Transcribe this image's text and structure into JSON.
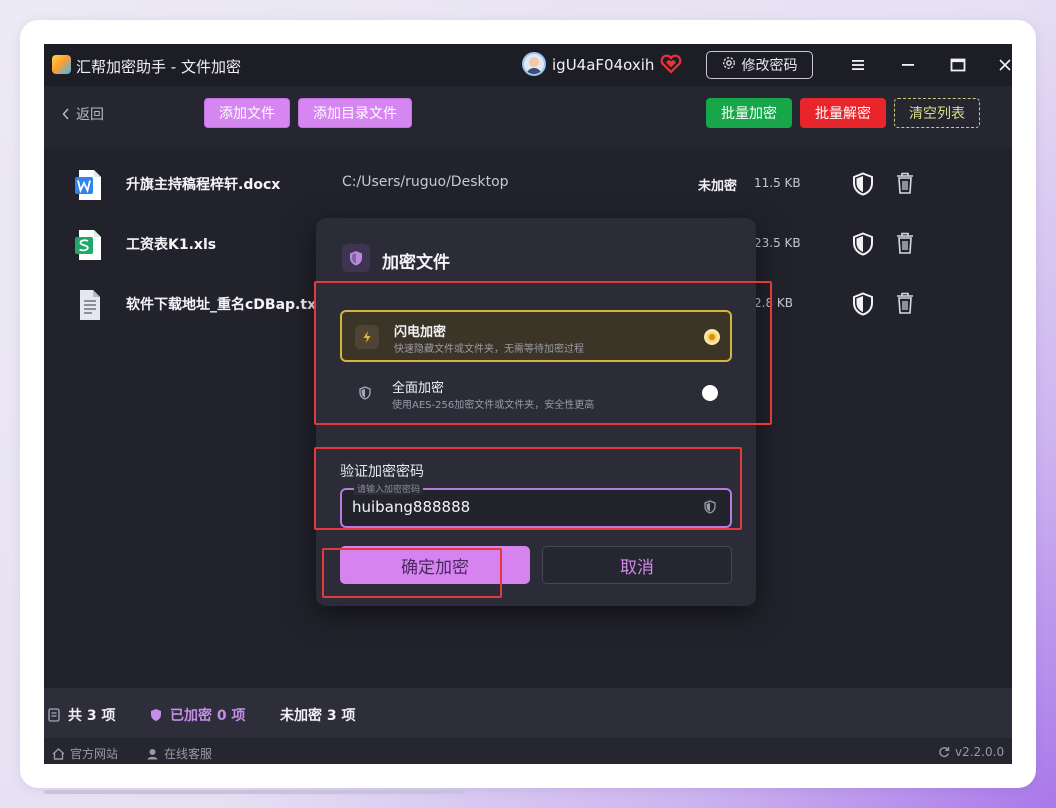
{
  "window": {
    "title": "汇帮加密助手 - 文件加密",
    "username": "igU4aF04oxih",
    "change_password_label": "修改密码",
    "buttons": {
      "menu": "≡",
      "minimize": "—",
      "maximize": "□",
      "close": "×"
    }
  },
  "toolbar": {
    "back_label": "返回",
    "add_file_label": "添加文件",
    "add_dir_label": "添加目录文件",
    "batch_encrypt_label": "批量加密",
    "batch_decrypt_label": "批量解密",
    "clear_list_label": "清空列表"
  },
  "files": [
    {
      "name": "升旗主持稿程梓轩.docx",
      "path": "C:/Users/ruguo/Desktop",
      "status": "未加密",
      "size": "11.5 KB",
      "icon": "word-doc-icon",
      "icon_color": "#2f86e8"
    },
    {
      "name": "工资表K1.xls",
      "path": "",
      "status": "",
      "size": "23.5 KB",
      "icon": "spreadsheet-icon",
      "icon_color": "#20a866"
    },
    {
      "name": "软件下载地址_重名cDBap.txt",
      "path": "",
      "status": "",
      "size": "2.8 KB",
      "icon": "text-file-icon",
      "icon_color": "#e6e6ee"
    }
  ],
  "dialog": {
    "title": "加密文件",
    "options": [
      {
        "title": "闪电加密",
        "desc": "快速隐藏文件或文件夹，无需等待加密过程",
        "selected": true,
        "icon": "lightning-icon"
      },
      {
        "title": "全面加密",
        "desc": "使用AES-256加密文件或文件夹，安全性更高",
        "selected": false,
        "icon": "shield-icon"
      }
    ],
    "password_label": "验证加密密码",
    "password_placeholder": "请输入加密密码",
    "password_value": "huibang888888",
    "confirm_label": "确定加密",
    "cancel_label": "取消"
  },
  "statusbar": {
    "total": "共 3 项",
    "encrypted": "已加密 0 项",
    "unencrypted": "未加密 3 项"
  },
  "footer": {
    "website": "官方网站",
    "support": "在线客服",
    "version": "v2.2.0.0"
  },
  "colors": {
    "accent_purple": "#d586f0",
    "batch_encrypt": "#18a64a",
    "batch_decrypt": "#e8252b",
    "selected_option_border": "#d8b23c",
    "annotation_red": "#e23a3a"
  }
}
